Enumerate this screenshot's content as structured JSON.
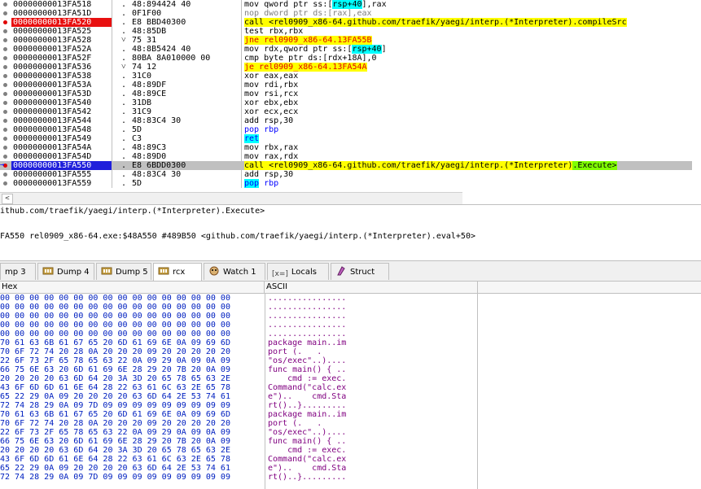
{
  "disassembly": {
    "rows": [
      {
        "addr": "00000000013FA518",
        "mark": ".",
        "bytes": "48:894424 40",
        "instr_html": "mov qword ptr ss:[<span class='bl'>rsp+40</span>],rax"
      },
      {
        "addr": "00000000013FA51D",
        "mark": ".",
        "bytes": "0F1F00",
        "instr_html": "<span class='kw-nop'>nop dword ptr ds:[rax],eax</span>"
      },
      {
        "addr": "00000000013FA520",
        "mark": ".",
        "bytes": "E8 BBD40300",
        "instr_html": "<span class='hl-yellow'>call &lt;rel0909_x86-64.github.com/traefik/yaegi/interp.(*Interpreter).compileSrc</span>",
        "bp": "red",
        "addr_style": "red"
      },
      {
        "addr": "00000000013FA525",
        "mark": ".",
        "bytes": "48:85DB",
        "instr_html": "test rbx,rbx"
      },
      {
        "addr": "00000000013FA528",
        "mark": "v",
        "bytes": "75 31",
        "instr_html": "<span class='hl-yellow kw-jmp'>jne rel0909_x86-64.13FA55B</span>"
      },
      {
        "addr": "00000000013FA52A",
        "mark": ".",
        "bytes": "48:8B5424 40",
        "instr_html": "mov rdx,qword ptr ss:[<span class='bl'>rsp+40</span>]"
      },
      {
        "addr": "00000000013FA52F",
        "mark": ".",
        "bytes": "80BA 8A010000 00",
        "instr_html": "cmp byte ptr ds:[rdx+18A],0"
      },
      {
        "addr": "00000000013FA536",
        "mark": "v",
        "bytes": "74 12",
        "instr_html": "<span class='hl-yellow kw-jmp'>je rel0909_x86-64.13FA54A</span>"
      },
      {
        "addr": "00000000013FA538",
        "mark": ".",
        "bytes": "31C0",
        "instr_html": "xor eax,eax"
      },
      {
        "addr": "00000000013FA53A",
        "mark": ".",
        "bytes": "48:89DF",
        "instr_html": "mov rdi,rbx"
      },
      {
        "addr": "00000000013FA53D",
        "mark": ".",
        "bytes": "48:89CE",
        "instr_html": "mov rsi,rcx"
      },
      {
        "addr": "00000000013FA540",
        "mark": ".",
        "bytes": "31DB",
        "instr_html": "xor ebx,ebx"
      },
      {
        "addr": "00000000013FA542",
        "mark": ".",
        "bytes": "31C9",
        "instr_html": "xor ecx,ecx"
      },
      {
        "addr": "00000000013FA544",
        "mark": ".",
        "bytes": "48:83C4 30",
        "instr_html": "add rsp,30"
      },
      {
        "addr": "00000000013FA548",
        "mark": ".",
        "bytes": "5D",
        "instr_html": "<span class='kw-pop'>pop rbp</span>"
      },
      {
        "addr": "00000000013FA549",
        "mark": ".",
        "bytes": "C3",
        "instr_html": "<span class='kw-ret'>ret</span>"
      },
      {
        "addr": "00000000013FA54A",
        "mark": ".",
        "bytes": "48:89C3",
        "instr_html": "mov rbx,rax"
      },
      {
        "addr": "00000000013FA54D",
        "mark": ".",
        "bytes": "48:89D0",
        "instr_html": "mov rax,rdx"
      },
      {
        "addr": "00000000013FA550",
        "mark": ".",
        "bytes": "E8 6BDD0300",
        "instr_html": "<span class='hl-yellow'>call &lt;rel0909_x86-64.github.com/traefik/yaegi/interp.(*Interpreter)</span><span class='hl-green'>.Execute&gt;</span>",
        "bp": "red",
        "addr_style": "bluehl",
        "selected": true
      },
      {
        "addr": "00000000013FA555",
        "mark": ".",
        "bytes": "48:83C4 30",
        "instr_html": "add rsp,30"
      },
      {
        "addr": "00000000013FA559",
        "mark": ".",
        "bytes": "5D",
        "instr_html": "<span class='kw-pop bl'>pop</span> <span class='kw-pop'>rbp</span>"
      }
    ]
  },
  "info": {
    "line1": "ithub.com/traefik/yaegi/interp.(*Interpreter).Execute>",
    "line2": "FA550 rel0909_x86-64.exe:$48A550 #489B50 <github.com/traefik/yaegi/interp.(*Interpreter).eval+50>"
  },
  "tabs": [
    {
      "label": "mp 3",
      "icon": "none-icon"
    },
    {
      "label": "Dump 4",
      "icon": "memory-icon"
    },
    {
      "label": "Dump 5",
      "icon": "memory-icon"
    },
    {
      "label": "rcx",
      "icon": "memory-icon",
      "active": true
    },
    {
      "label": "Watch 1",
      "icon": "watch-icon"
    },
    {
      "label": "Locals",
      "icon": "locals-icon",
      "prefix": "[x=]"
    },
    {
      "label": "Struct",
      "icon": "struct-icon"
    }
  ],
  "dump": {
    "hex_header": "Hex",
    "ascii_header": "ASCII",
    "rows": [
      {
        "hex": "00 00 00 00 00 00 00 00 00 00 00 00 00 00 00 00",
        "ascii": "................"
      },
      {
        "hex": "00 00 00 00 00 00 00 00 00 00 00 00 00 00 00 00",
        "ascii": "................"
      },
      {
        "hex": "00 00 00 00 00 00 00 00 00 00 00 00 00 00 00 00",
        "ascii": "................"
      },
      {
        "hex": "00 00 00 00 00 00 00 00 00 00 00 00 00 00 00 00",
        "ascii": "................"
      },
      {
        "hex": "00 00 00 00 00 00 00 00 00 00 00 00 00 00 00 00",
        "ascii": "................"
      },
      {
        "hex": "70 61 63 6B 61 67 65 20 6D 61 69 6E 0A 09 69 6D",
        "ascii": "package main..im"
      },
      {
        "hex": "70 6F 72 74 20 28 0A 20 20 20 09 20 20 20 20 20",
        "ascii": "port (.   .     "
      },
      {
        "hex": "22 6F 73 2F 65 78 65 63 22 0A 09 29 0A 09 0A 09",
        "ascii": "\"os/exec\"..)...."
      },
      {
        "hex": "66 75 6E 63 20 6D 61 69 6E 28 29 20 7B 20 0A 09",
        "ascii": "func main() { .."
      },
      {
        "hex": "20 20 20 20 63 6D 64 20 3A 3D 20 65 78 65 63 2E",
        "ascii": "    cmd := exec."
      },
      {
        "hex": "43 6F 6D 6D 61 6E 64 28 22 63 61 6C 63 2E 65 78",
        "ascii": "Command(\"calc.ex"
      },
      {
        "hex": "65 22 29 0A 09 20 20 20 20 63 6D 64 2E 53 74 61",
        "ascii": "e\")..    cmd.Sta"
      },
      {
        "hex": "72 74 28 29 0A 09 7D 09 09 09 09 09 09 09 09 09",
        "ascii": "rt()..}........."
      },
      {
        "hex": "70 61 63 6B 61 67 65 20 6D 61 69 6E 0A 09 69 6D",
        "ascii": "package main..im"
      },
      {
        "hex": "70 6F 72 74 20 28 0A 20 20 20 09 20 20 20 20 20",
        "ascii": "port (.   .     "
      },
      {
        "hex": "22 6F 73 2F 65 78 65 63 22 0A 09 29 0A 09 0A 09",
        "ascii": "\"os/exec\"..)...."
      },
      {
        "hex": "66 75 6E 63 20 6D 61 69 6E 28 29 20 7B 20 0A 09",
        "ascii": "func main() { .."
      },
      {
        "hex": "20 20 20 20 63 6D 64 20 3A 3D 20 65 78 65 63 2E",
        "ascii": "    cmd := exec."
      },
      {
        "hex": "43 6F 6D 6D 61 6E 64 28 22 63 61 6C 63 2E 65 78",
        "ascii": "Command(\"calc.ex"
      },
      {
        "hex": "65 22 29 0A 09 20 20 20 20 63 6D 64 2E 53 74 61",
        "ascii": "e\")..    cmd.Sta"
      },
      {
        "hex": "72 74 28 29 0A 09 7D 09 09 09 09 09 09 09 09 09",
        "ascii": "rt()..}........."
      }
    ]
  }
}
